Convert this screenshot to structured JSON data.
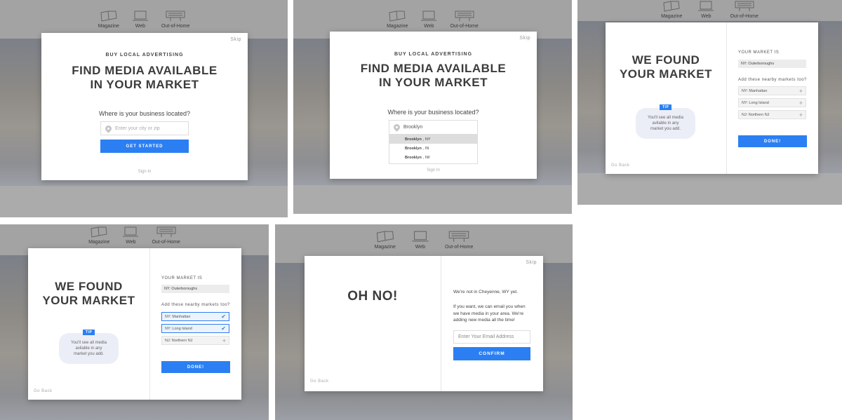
{
  "nav": {
    "magazine": "Magazine",
    "web": "Web",
    "ooh": "Out-of-Home"
  },
  "common": {
    "skip": "Skip",
    "sign_in": "Sign In",
    "go_back": "Go Back"
  },
  "screen1": {
    "eyebrow": "BUY LOCAL ADVERTISING",
    "title_line1": "FIND MEDIA AVAILABLE",
    "title_line2": "IN YOUR MARKET",
    "question": "Where is your business located?",
    "input_placeholder": "Enter your city or zip",
    "button": "GET STARTED"
  },
  "screen2": {
    "input_value": "Brooklyn",
    "suggestions": [
      {
        "bold": "Brooklyn",
        "rest": ", NY"
      },
      {
        "bold": "Brooklyn",
        "rest": ", IN"
      },
      {
        "bold": "Brooklyn",
        "rest": ", IW"
      }
    ]
  },
  "found": {
    "title_line1": "WE FOUND",
    "title_line2": "YOUR MARKET",
    "tip_tag": "TIP",
    "tip_line1": "You'll see all media",
    "tip_line2": "avilable in any",
    "tip_line3": "market you add.",
    "market_label": "YOUR MARKET IS",
    "market_value": "NY: Outerboroughs",
    "nearby_label": "Add these nearby markets too?",
    "nearby": [
      "NY: Manhattan",
      "NY: Long Island",
      "NJ: Northern NJ"
    ],
    "button": "DONE!"
  },
  "screen4": {
    "selected": [
      true,
      true,
      false
    ]
  },
  "ohno": {
    "title": "OH NO!",
    "line1": "We're not in Cheyenne, WY yet.",
    "line2": "If you want, we can email you when",
    "line3": "we have media in your area. We're",
    "line4": "adding new media all the time!",
    "email_placeholder": "Enter Your Email Address",
    "button": "CONFIRM"
  }
}
